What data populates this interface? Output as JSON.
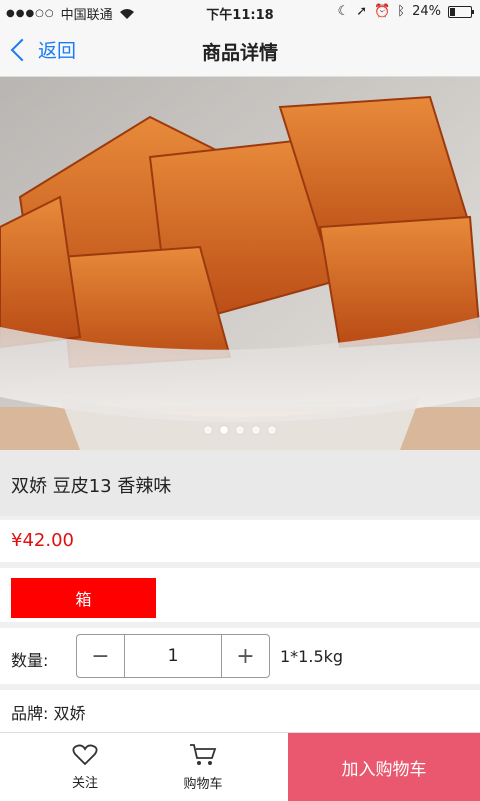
{
  "status_bar": {
    "carrier": "中国联通",
    "time": "下午11:18",
    "battery": "24%",
    "battery_level": 0.24
  },
  "nav": {
    "back_label": "返回",
    "title": "商品详情"
  },
  "gallery": {
    "image_desc": "product-photo",
    "page_count": 5,
    "current_page": 2
  },
  "product": {
    "name": "双娇  豆皮13 香辣味",
    "price": "¥42.00",
    "spec_option": "箱",
    "quantity_label": "数量:",
    "quantity": "1",
    "package": "1*1.5kg",
    "brand": "品牌:  双娇"
  },
  "bottom": {
    "follow_label": "关注",
    "cart_label": "购物车",
    "add_to_cart_label": "加入购物车"
  },
  "colors": {
    "accent_blue": "#1a7cf5",
    "price_red": "#e01010",
    "spec_red": "#fe0000",
    "cart_pink": "#e9586e"
  }
}
